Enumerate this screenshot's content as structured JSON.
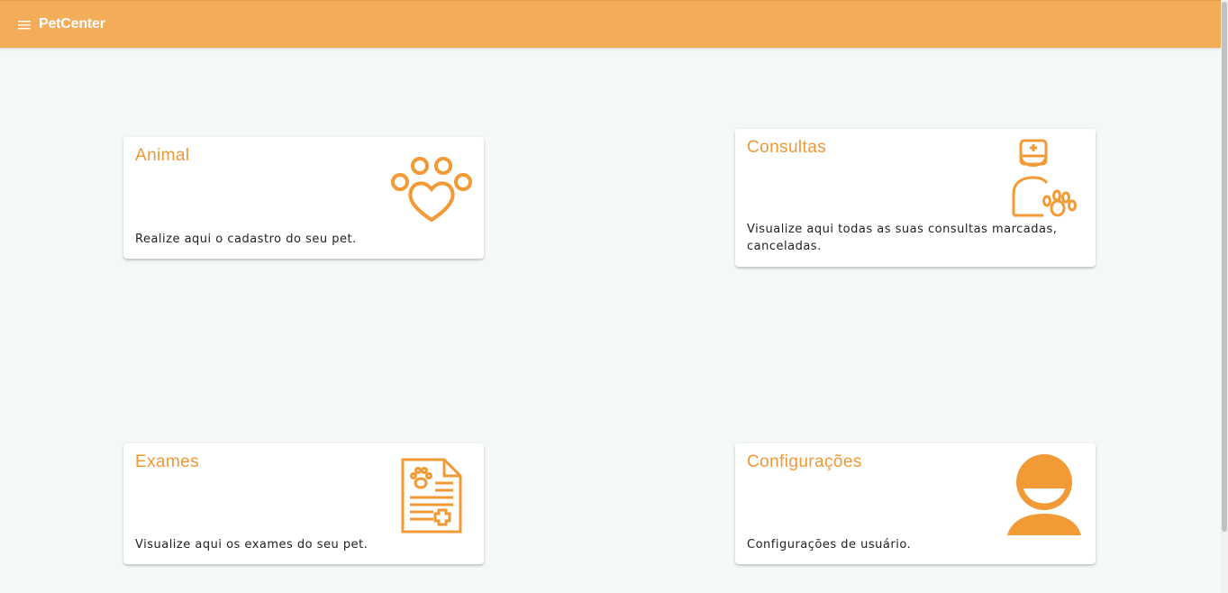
{
  "header": {
    "title": "PetCenter",
    "menu_icon": "hamburger-menu-icon",
    "background_color": "#f3ad58"
  },
  "accent_color": "#ee9837",
  "cards": [
    {
      "title": "Animal",
      "description": "Realize aqui o cadastro do seu pet.",
      "icon": "paw-heart-icon"
    },
    {
      "title": "Consultas",
      "description": "Visualize aqui todas as suas consultas marcadas,",
      "description_line2": "canceladas.",
      "icon": "veterinarian-icon"
    },
    {
      "title": "Exames",
      "description": "Visualize aqui os exames do seu pet.",
      "icon": "medical-report-icon"
    },
    {
      "title": "Configurações",
      "description": "Configurações de usuário.",
      "icon": "user-avatar-icon"
    }
  ]
}
